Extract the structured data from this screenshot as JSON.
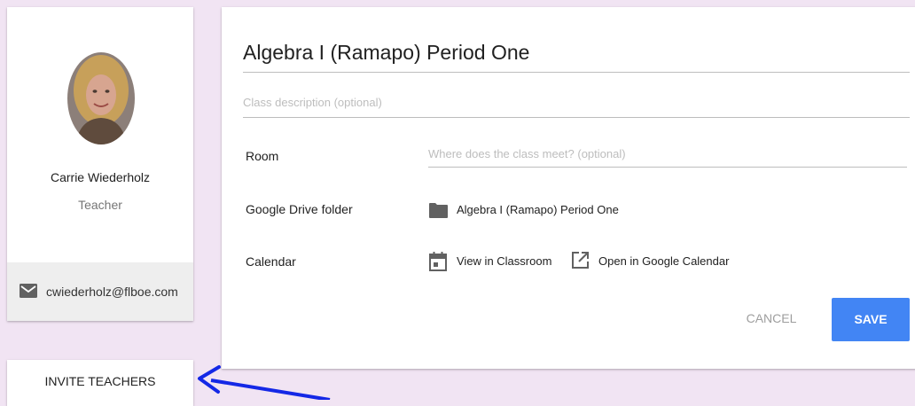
{
  "profile": {
    "name": "Carrie Wiederholz",
    "role": "Teacher",
    "email": "cwiederholz@flboe.com"
  },
  "invite": {
    "label": "INVITE TEACHERS"
  },
  "class": {
    "title": "Algebra I (Ramapo) Period One",
    "description_placeholder": "Class description (optional)",
    "room_label": "Room",
    "room_placeholder": "Where does the class meet? (optional)",
    "drive_label": "Google Drive folder",
    "drive_folder": "Algebra I (Ramapo) Period One",
    "calendar_label": "Calendar",
    "calendar_view": "View in Classroom",
    "calendar_open": "Open in Google Calendar"
  },
  "actions": {
    "cancel": "CANCEL",
    "save": "SAVE"
  },
  "icons": {
    "email": "mail-icon",
    "folder": "folder-icon",
    "calendar": "calendar-icon",
    "external": "open-in-new-icon"
  },
  "colors": {
    "background": "#f1e4f3",
    "primary": "#4285f4",
    "annotation_arrow": "#1428e6"
  }
}
